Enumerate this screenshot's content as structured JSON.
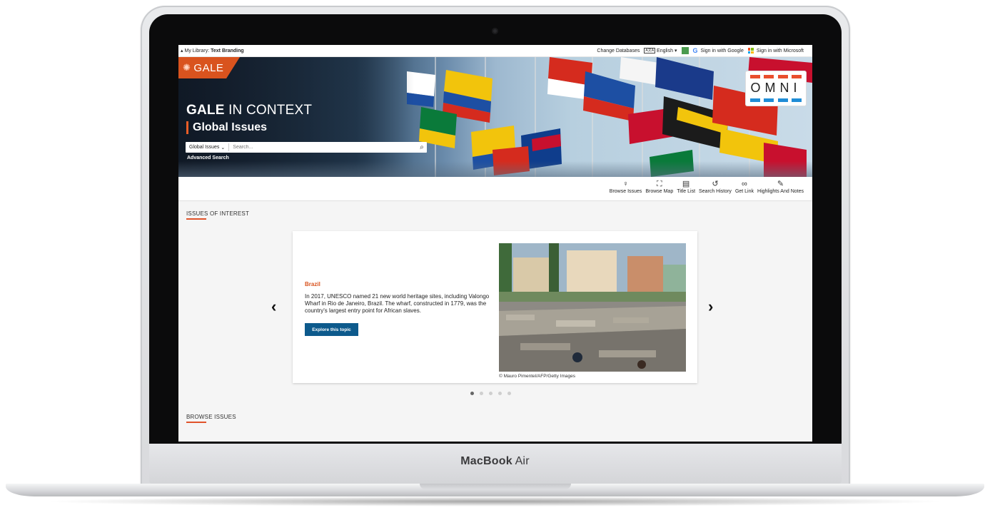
{
  "device": {
    "label_bold": "MacBook",
    "label_light": "Air"
  },
  "topbar": {
    "my_library_prefix": "My Library:",
    "my_library_name": "Text Branding",
    "change_databases": "Change Databases",
    "language_badge": "A文A",
    "language": "English",
    "sign_in_google": "Sign in with Google",
    "sign_in_microsoft": "Sign in with Microsoft"
  },
  "hero": {
    "brand_badge": "GALE",
    "product_title_bold": "GALE",
    "product_title_rest": "IN CONTEXT",
    "product_subtitle": "Global Issues",
    "search_scope": "Global Issues",
    "search_placeholder": "Search...",
    "advanced_search": "Advanced Search",
    "partner_logo": "OMNI"
  },
  "tools": [
    {
      "label": "Browse Issues",
      "icon": "lightbulb-icon"
    },
    {
      "label": "Browse Map",
      "icon": "map-icon"
    },
    {
      "label": "Title List",
      "icon": "list-icon"
    },
    {
      "label": "Search History",
      "icon": "history-icon"
    },
    {
      "label": "Get Link",
      "icon": "link-icon"
    },
    {
      "label": "Highlights And Notes",
      "icon": "pencil-icon"
    }
  ],
  "issues_of_interest": {
    "heading": "ISSUES OF INTEREST",
    "slide": {
      "topic": "Brazil",
      "description": "In 2017, UNESCO named 21 new world heritage sites, including Valongo Wharf in Rio de Janeiro, Brazil. The wharf, constructed in 1779, was the country's largest entry point for African slaves.",
      "button": "Explore this topic",
      "credit": "© Mauro Pimentel/AFP/Getty Images"
    },
    "dots_total": 5,
    "active_dot": 1
  },
  "browse_issues": {
    "heading": "BROWSE ISSUES"
  },
  "colors": {
    "accent": "#d9531e",
    "button": "#0d5a8c"
  }
}
